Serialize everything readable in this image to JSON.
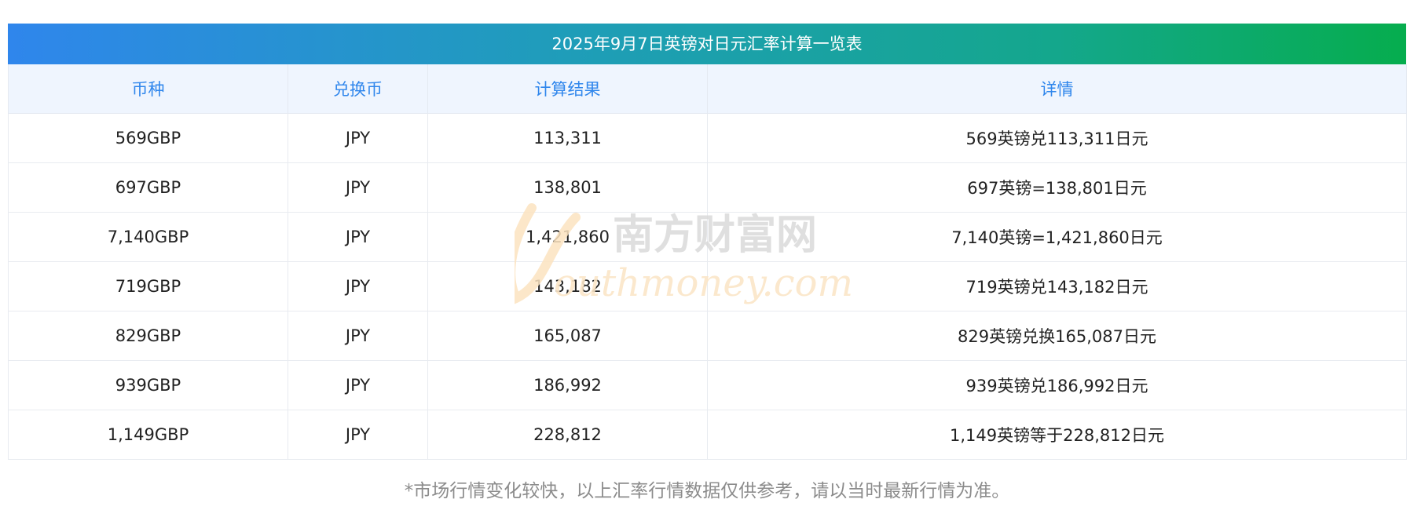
{
  "title": "2025年9月7日英镑对日元汇率计算一览表",
  "columns": [
    "币种",
    "兑换币",
    "计算结果",
    "详情"
  ],
  "rows": [
    {
      "currency": "569GBP",
      "target": "JPY",
      "result": "113,311",
      "detail": "569英镑兑113,311日元"
    },
    {
      "currency": "697GBP",
      "target": "JPY",
      "result": "138,801",
      "detail": "697英镑=138,801日元"
    },
    {
      "currency": "7,140GBP",
      "target": "JPY",
      "result": "1,421,860",
      "detail": "7,140英镑=1,421,860日元"
    },
    {
      "currency": "719GBP",
      "target": "JPY",
      "result": "143,182",
      "detail": "719英镑兑143,182日元"
    },
    {
      "currency": "829GBP",
      "target": "JPY",
      "result": "165,087",
      "detail": "829英镑兑换165,087日元"
    },
    {
      "currency": "939GBP",
      "target": "JPY",
      "result": "186,992",
      "detail": "939英镑兑186,992日元"
    },
    {
      "currency": "1,149GBP",
      "target": "JPY",
      "result": "228,812",
      "detail": "1,149英镑等于228,812日元"
    }
  ],
  "footnote": "*市场行情变化较快，以上汇率行情数据仅供参考，请以当时最新行情为准。",
  "watermark": {
    "cn": "南方财富网",
    "en": "outhmoney.com"
  },
  "colors": {
    "accent": "#2f86ec",
    "header_bg": "#eff5fe",
    "grad_start": "#2f86ec",
    "grad_end": "#06ad4e"
  }
}
